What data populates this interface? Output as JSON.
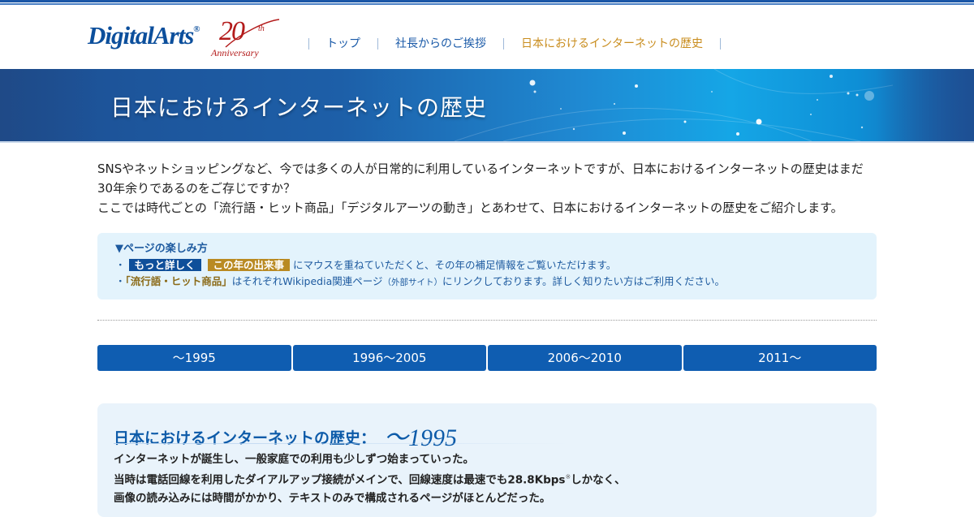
{
  "header": {
    "logo_text": "DigitalArts",
    "logo_mark": "®",
    "anniversary_number": "20",
    "anniversary_suffix": "th",
    "anniversary_word": "Anniversary"
  },
  "nav": {
    "items": [
      {
        "label": "トップ",
        "active": false
      },
      {
        "label": "社長からのご挨拶",
        "active": false
      },
      {
        "label": "日本におけるインターネットの歴史",
        "active": true
      }
    ]
  },
  "banner": {
    "title": "日本におけるインターネットの歴史"
  },
  "intro": {
    "line1": "SNSやネットショッピングなど、今では多くの人が日常的に利用しているインターネットですが、日本におけるインターネットの歴史はまだ30年余りであるのをご存じですか？",
    "line2": "ここでは時代ごとの「流行語・ヒット商品」「デジタルアーツの動き」とあわせて、日本におけるインターネットの歴史をご紹介します。"
  },
  "howto": {
    "heading": "▼ページの楽しみ方",
    "bullet": "・",
    "tag_more": "もっと詳しく",
    "tag_event": "この年の出来事",
    "line1_rest": "にマウスを重ねていただくと、その年の補足情報をご覧いただけます。",
    "line2_keyword": "「流行語・ヒット商品」",
    "line2_mid": "はそれぞれWikipedia関連ページ",
    "line2_small": "（外部サイト）",
    "line2_rest": "にリンクしております。詳しく知りたい方はご利用ください。"
  },
  "tabs": [
    "～1995",
    "1996～2005",
    "2006～2010",
    "2011～"
  ],
  "era": {
    "title": "日本におけるインターネットの歴史：",
    "year": "～1995",
    "line1": "インターネットが誕生し、一般家庭での利用も少しずつ始まっていった。",
    "line2_a": "当時は電話回線を利用したダイアルアップ接続がメインで、回線速度は最速でも28.8Kbps",
    "line2_note": "※",
    "line2_b": "しかなく、",
    "line3": "画像の読み込みには時間がかかり、テキストのみで構成されるページがほとんどだった。"
  },
  "colors": {
    "brand_blue": "#0c4f9c",
    "nav_active": "#c98d1e",
    "tab_blue": "#0f5db1",
    "howto_bg": "#e3f3fc",
    "era_bg": "#e9f3fb"
  }
}
